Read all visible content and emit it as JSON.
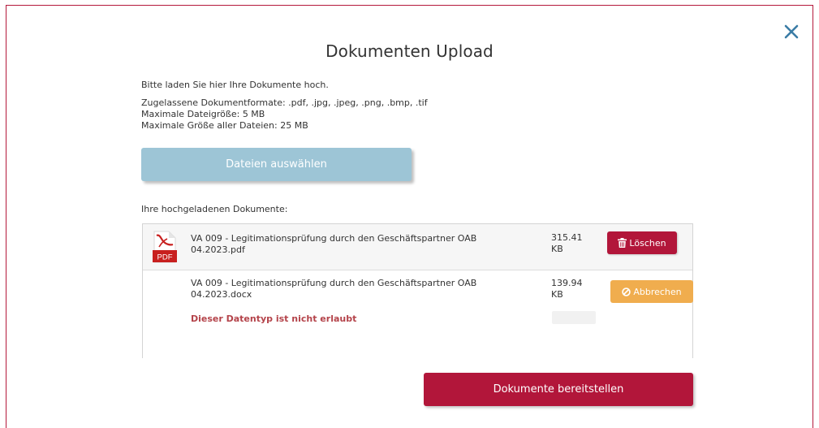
{
  "dialog": {
    "title": "Dokumenten Upload",
    "close_icon": "close-icon",
    "intro": "Bitte laden Sie hier Ihre Dokumente hoch.",
    "formats": "Zugelassene Dokumentformate: .pdf, .jpg, .jpeg, .png, .bmp, .tif",
    "max_file_size": "Maximale Dateigröße: 5 MB",
    "max_total_size": "Maximale Größe aller Dateien: 25 MB",
    "select_button": "Dateien auswählen",
    "uploaded_heading": "Ihre hochgeladenen Dokumente:",
    "submit_button": "Dokumente bereitstellen"
  },
  "files": [
    {
      "name": "VA 009 - Legitimationsprüfung durch den Geschäftspartner OAB 04.2023.pdf",
      "size": "315.41 KB",
      "icon": "pdf-file-icon",
      "icon_label": "PDF",
      "action": "Löschen",
      "action_icon": "trash-icon"
    },
    {
      "name": "VA 009 - Legitimationsprüfung durch den Geschäftspartner OAB 04.2023.docx",
      "size": "139.94 KB",
      "error": "Dieser Datentyp ist nicht erlaubt",
      "progress": 0,
      "action": "Abbrechen",
      "action_icon": "ban-icon"
    }
  ],
  "colors": {
    "primary": "#b2163a",
    "select_button": "#9dc5d6",
    "warning": "#f0ad4e",
    "error_text": "#b4434a",
    "close_icon": "#3a7ca5"
  }
}
